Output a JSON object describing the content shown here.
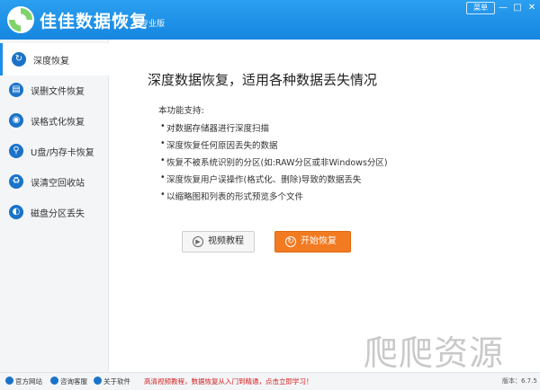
{
  "app": {
    "title": "佳佳数据恢复",
    "edition": "专业版",
    "menu_label": "菜单",
    "minimize_glyph": "—",
    "maximize_glyph": "□",
    "close_glyph": "✕",
    "accent_color": "#1a8ee8"
  },
  "sidebar": {
    "items": [
      {
        "label": "深度恢复",
        "icon": "deep-recovery-icon",
        "active": true
      },
      {
        "label": "误删文件恢复",
        "icon": "deleted-file-icon",
        "active": false
      },
      {
        "label": "误格式化恢复",
        "icon": "format-recovery-icon",
        "active": false
      },
      {
        "label": "U盘/内存卡恢复",
        "icon": "usb-drive-icon",
        "active": false
      },
      {
        "label": "误清空回收站",
        "icon": "recycle-bin-icon",
        "active": false
      },
      {
        "label": "磁盘分区丢失",
        "icon": "disk-partition-icon",
        "active": false
      }
    ]
  },
  "main": {
    "title": "深度数据恢复，适用各种数据丢失情况",
    "features_heading": "本功能支持:",
    "features": [
      "对数据存储器进行深度扫描",
      "深度恢复任何原因丢失的数据",
      "恢复不被系统识别的分区(如:RAW分区或非Windows分区)",
      "深度恢复用户误操作(格式化、删除)导致的数据丢失",
      "以缩略图和列表的形式预览多个文件"
    ],
    "video_button": "视频教程",
    "start_button": "开始恢复",
    "start_button_color": "#f27a20"
  },
  "footer": {
    "links": [
      "官方网站",
      "咨询客服",
      "关于软件"
    ],
    "promo": "高清视频教程，数据恢复从入门到精通，点击立即学习！",
    "version": "版本：6.7.5",
    "promo_color": "#d61e1e"
  },
  "watermark": {
    "text": "爬爬资源"
  }
}
